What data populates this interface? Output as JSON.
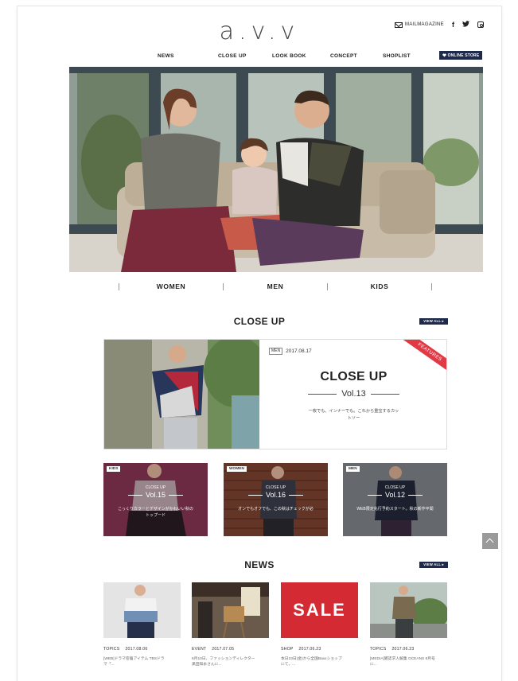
{
  "header": {
    "logo": "a.v.v",
    "mailmagazine": "MAILMAGAZINE",
    "facebook": "f",
    "twitter": "•",
    "online_store": "ONLINE STORE"
  },
  "nav": [
    "NEWS",
    "CLOSE UP",
    "LOOK BOOK",
    "CONCEPT",
    "SHOPLIST"
  ],
  "gender_tabs": [
    "WOMEN",
    "MEN",
    "KIDS"
  ],
  "closeup": {
    "title": "CLOSE UP",
    "view_all": "VIEW ALL ▸",
    "feature": {
      "tag": "MEN",
      "date": "2017.08.17",
      "ribbon": "FEATURES",
      "heading": "CLOSE UP",
      "vol": "Vol.13",
      "text_line1": "一枚でも、インナーでも。これから重宝するカッ",
      "text_line2": "トソー"
    },
    "cards": [
      {
        "tag": "KIDS",
        "heading": "CLOSE UP",
        "vol": "Vol.15",
        "text1": "こっくりカラーとデザインがかわいい秋の",
        "text2": "トップード"
      },
      {
        "tag": "WOMEN",
        "heading": "CLOSE UP",
        "vol": "Vol.16",
        "text1": "オンでもオフでも、この秋はチェックが必",
        "text2": ""
      },
      {
        "tag": "MEN",
        "heading": "CLOSE UP",
        "vol": "Vol.12",
        "text1": "WEB限定先行予約スタート。秋の新作平間",
        "text2": ""
      }
    ]
  },
  "news": {
    "title": "NEWS",
    "view_all": "VIEW ALL ▸",
    "items": [
      {
        "meta": "TOPICS 　2017.08.06",
        "text1": "[WEB]ドラマ密着アイテム TBSドラ",
        "text2": "マ「..."
      },
      {
        "meta": "EVENT 　2017.07.05",
        "text1": "6月10日、ファッションディレクター",
        "text2": "黒田知永さんに..."
      },
      {
        "meta": "SHOP 　2017.06.23",
        "text1": "本日23日(金)から全国Baxxショップ",
        "text2": "にて。..."
      },
      {
        "meta": "TOPICS 　2017.06.23",
        "text1": "[MEDIA]雑誌求人解集 OCEANS 8月号",
        "text2": "に..."
      }
    ],
    "sale_label": "SALE"
  },
  "colors": {
    "navy": "#1e2a4a",
    "ribbon": "#e23a45",
    "sale_red": "#d42a33"
  }
}
